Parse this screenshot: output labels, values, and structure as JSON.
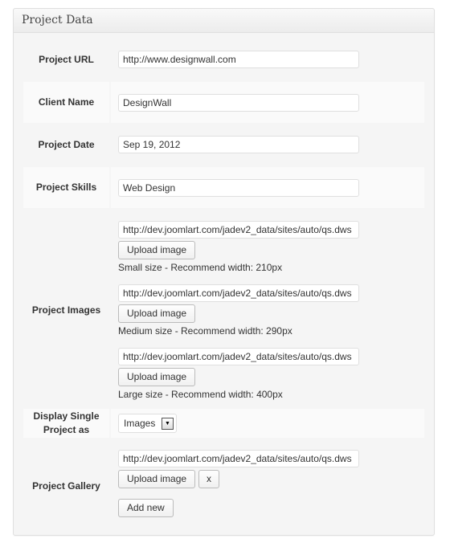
{
  "panel": {
    "title": "Project Data"
  },
  "fields": {
    "project_url": {
      "label": "Project URL",
      "value": "http://www.designwall.com"
    },
    "client_name": {
      "label": "Client Name",
      "value": "DesignWall"
    },
    "project_date": {
      "label": "Project Date",
      "value": "Sep 19, 2012"
    },
    "project_skills": {
      "label": "Project Skills",
      "value": "Web Design"
    },
    "project_images": {
      "label": "Project Images",
      "items": [
        {
          "value": "http://dev.joomlart.com/jadev2_data/sites/auto/qs.dws",
          "button": "Upload image",
          "hint": "Small size - Recommend width: 210px"
        },
        {
          "value": "http://dev.joomlart.com/jadev2_data/sites/auto/qs.dws",
          "button": "Upload image",
          "hint": "Medium size - Recommend width: 290px"
        },
        {
          "value": "http://dev.joomlart.com/jadev2_data/sites/auto/qs.dws",
          "button": "Upload image",
          "hint": "Large size - Recommend width: 400px"
        }
      ]
    },
    "display_single": {
      "label": "Display Single Project as",
      "selected": "Images",
      "arrow_icon": "▼"
    },
    "project_gallery": {
      "label": "Project Gallery",
      "value": "http://dev.joomlart.com/jadev2_data/sites/auto/qs.dws",
      "upload_button": "Upload image",
      "remove_button": "x",
      "add_button": "Add new"
    }
  }
}
